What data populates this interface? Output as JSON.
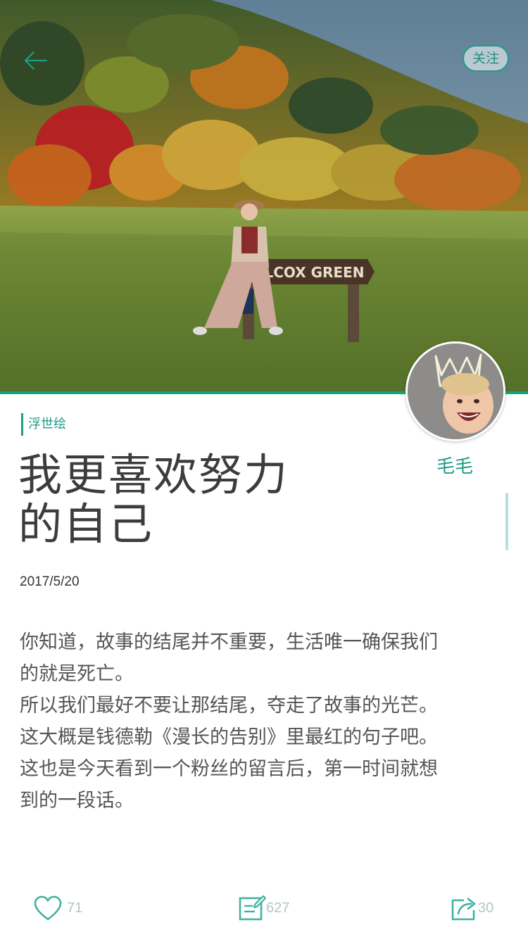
{
  "header": {
    "follow_label": "关注"
  },
  "hero": {
    "sign_text": "WILCOX GREEN"
  },
  "author": {
    "name": "毛毛"
  },
  "article": {
    "category": "浮世绘",
    "title_line1": "我更喜欢努力",
    "title_line2": "的自己",
    "date": "2017/5/20",
    "paragraphs": [
      "你知道，故事的结尾并不重要，生活唯一确保我们的就是死亡。",
      "所以我们最好不要让那结尾，夺走了故事的光芒。",
      "这大概是钱德勒《漫长的告别》里最红的句子吧。",
      "这也是今天看到一个粉丝的留言后，第一时间就想到的一段话。"
    ]
  },
  "actions": {
    "likes": "71",
    "comments": "627",
    "shares": "30"
  },
  "colors": {
    "accent": "#1f9c86",
    "count_gray": "#b5c6c3"
  },
  "icons": {
    "back": "arrow-left-icon",
    "like": "heart-icon",
    "comment": "edit-note-icon",
    "share": "share-icon"
  }
}
